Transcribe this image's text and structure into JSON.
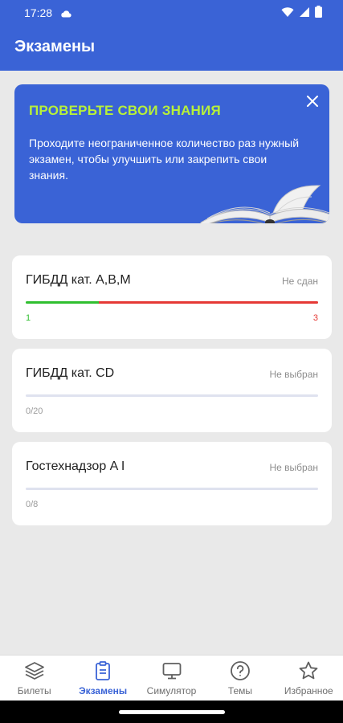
{
  "status_bar": {
    "time": "17:28"
  },
  "app_bar": {
    "title": "Экзамены"
  },
  "promo": {
    "title": "ПРОВЕРЬТЕ СВОИ ЗНАНИЯ",
    "text": "Проходите неограниченное количество раз нужный экзамен, чтобы улучшить или закрепить свои знания."
  },
  "exams": [
    {
      "name": "ГИБДД кат. A,B,M",
      "status": "Не сдан",
      "correct": "1",
      "wrong": "3",
      "correct_fraction": 0.25,
      "wrong_fraction": 0.75
    },
    {
      "name": "ГИБДД кат. CD",
      "status": "Не выбран",
      "progress": "0/20"
    },
    {
      "name": "Гостехнадзор A I",
      "status": "Не выбран",
      "progress": "0/8"
    }
  ],
  "bottom_nav": [
    {
      "label": "Билеты",
      "icon": "layers-icon"
    },
    {
      "label": "Экзамены",
      "icon": "clipboard-icon",
      "active": true
    },
    {
      "label": "Симулятор",
      "icon": "monitor-icon"
    },
    {
      "label": "Темы",
      "icon": "question-icon"
    },
    {
      "label": "Избранное",
      "icon": "star-icon"
    }
  ],
  "colors": {
    "primary": "#3a63d6",
    "promo_title": "#b7f03a",
    "correct": "#2fbf2f",
    "wrong": "#e53935",
    "background": "#e9e9e9"
  }
}
